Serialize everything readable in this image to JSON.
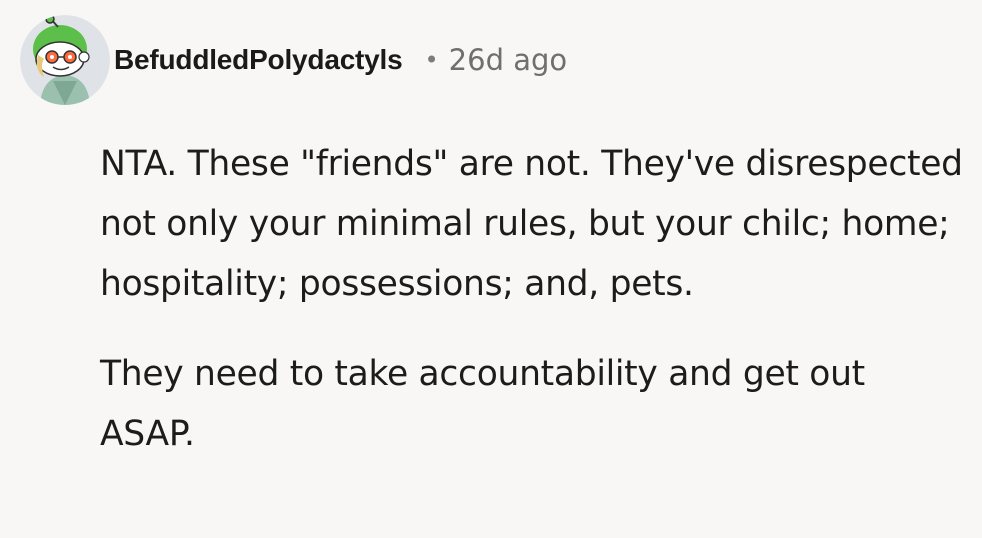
{
  "comment": {
    "author": "BefuddledPolydactyls",
    "separator": "•",
    "age": "26d ago",
    "avatar_icon": "snoo-avatar-icon",
    "paragraphs": [
      "NTA. These \"friends\" are not. They've disrespected not only your minimal rules, but your chilc; home; hospitality; possessions; and, pets.",
      "They need to take accountability and get out ASAP."
    ]
  },
  "colors": {
    "background": "#f8f7f6",
    "text": "#1c1c1c",
    "meta": "#6f6f6f"
  }
}
